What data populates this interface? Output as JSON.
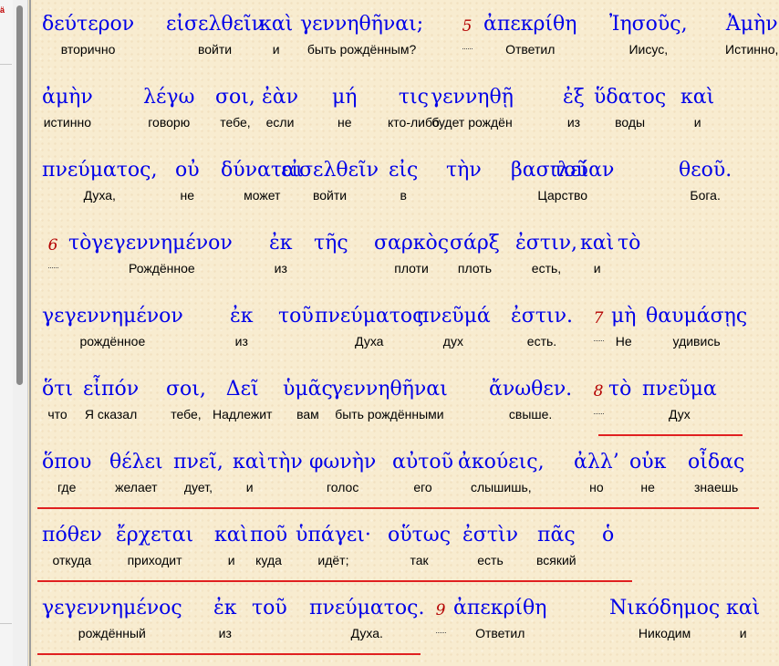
{
  "colors": {
    "greek": "#0000e8",
    "gloss": "#000000",
    "verse_number": "#b30000",
    "highlight_line": "#e02020",
    "background": "#f8ecd0"
  },
  "left_pane": {
    "marker": "ä"
  },
  "lines": [
    {
      "words": [
        {
          "gk": "δεύτερον",
          "ru": "вторично"
        },
        {
          "gk": "εἰσελθεῖν",
          "ru": "войти"
        },
        {
          "gk": "καὶ",
          "ru": "и"
        },
        {
          "gk": "γεννηθῆναι;",
          "ru": "быть рождённым?"
        },
        {
          "verse": "5"
        },
        {
          "gk": "ἀπεκρίθη",
          "ru": "Ответил"
        },
        {
          "gk": "Ἰησοῦς,",
          "ru": "Иисус,"
        },
        {
          "gk": "Ἀμὴν",
          "ru": "Истинно,"
        }
      ]
    },
    {
      "words": [
        {
          "gk": "ἀμὴν",
          "ru": "истинно"
        },
        {
          "gk": "λέγω",
          "ru": "говорю"
        },
        {
          "gk": "σοι,",
          "ru": "тебе,"
        },
        {
          "gk": "ἐὰν",
          "ru": "если"
        },
        {
          "gk": "μή",
          "ru": "не"
        },
        {
          "gk": "τις",
          "ru": "кто-либо"
        },
        {
          "gk": "γεννηθῇ",
          "ru": "будет рождён"
        },
        {
          "gk": "ἐξ",
          "ru": "из"
        },
        {
          "gk": "ὕδατος",
          "ru": "воды"
        },
        {
          "gk": "καὶ",
          "ru": "и"
        }
      ]
    },
    {
      "words": [
        {
          "gk": "πνεύματος,",
          "ru": "Духа,"
        },
        {
          "gk": "οὐ",
          "ru": "не"
        },
        {
          "gk": "δύναται",
          "ru": "может"
        },
        {
          "gk": "εἰσελθεῖν",
          "ru": "войти"
        },
        {
          "gk": "εἰς",
          "ru": "в"
        },
        {
          "gk": "τὴν",
          "ru": ""
        },
        {
          "gk": "βασιλείαν",
          "ru": "Царство"
        },
        {
          "gk": "τοῦ",
          "ru": ""
        },
        {
          "gk": "θεοῦ.",
          "ru": "Бога."
        }
      ]
    },
    {
      "words": [
        {
          "verse": "6"
        },
        {
          "gk": "τὸ",
          "ru": ""
        },
        {
          "gk": "γεγεννημένον",
          "ru": "Рождённое"
        },
        {
          "gk": "ἐκ",
          "ru": "из"
        },
        {
          "gk": "τῆς",
          "ru": ""
        },
        {
          "gk": "σαρκὸς",
          "ru": "плоти"
        },
        {
          "gk": "σάρξ",
          "ru": "плоть"
        },
        {
          "gk": "ἐστιν,",
          "ru": "есть,"
        },
        {
          "gk": "καὶ",
          "ru": "и"
        },
        {
          "gk": "τὸ",
          "ru": ""
        }
      ]
    },
    {
      "words": [
        {
          "gk": "γεγεννημένον",
          "ru": "рождённое"
        },
        {
          "gk": "ἐκ",
          "ru": "из"
        },
        {
          "gk": "τοῦ",
          "ru": ""
        },
        {
          "gk": "πνεύματος",
          "ru": "Духа"
        },
        {
          "gk": "πνεῦμά",
          "ru": "дух"
        },
        {
          "gk": "ἐστιν.",
          "ru": "есть."
        },
        {
          "verse": "7"
        },
        {
          "gk": "μὴ",
          "ru": "Не"
        },
        {
          "gk": "θαυμάσῃς",
          "ru": "удивись"
        }
      ]
    },
    {
      "words": [
        {
          "gk": "ὅτι",
          "ru": "что"
        },
        {
          "gk": "εἶπόν",
          "ru": "Я сказал"
        },
        {
          "gk": "σοι,",
          "ru": "тебе,"
        },
        {
          "gk": "Δεῖ",
          "ru": "Надлежит"
        },
        {
          "gk": "ὑμᾶς",
          "ru": "вам"
        },
        {
          "gk": "γεννηθῆναι",
          "ru": "быть рождёнными"
        },
        {
          "gk": "ἄνωθεν.",
          "ru": "свыше."
        },
        {
          "verse": "8"
        },
        {
          "gk": "τὸ",
          "ru": ""
        },
        {
          "gk": "πνεῦμα",
          "ru": "Дух"
        }
      ]
    },
    {
      "words": [
        {
          "gk": "ὅπου",
          "ru": "где"
        },
        {
          "gk": "θέλει",
          "ru": "желает"
        },
        {
          "gk": "πνεῖ,",
          "ru": "дует,"
        },
        {
          "gk": "καὶ",
          "ru": "и"
        },
        {
          "gk": "τὴν",
          "ru": ""
        },
        {
          "gk": "φωνὴν",
          "ru": "голос"
        },
        {
          "gk": "αὐτοῦ",
          "ru": "его"
        },
        {
          "gk": "ἀκούεις,",
          "ru": "слышишь,"
        },
        {
          "gk": "ἀλλ’",
          "ru": "но"
        },
        {
          "gk": "οὐκ",
          "ru": "не"
        },
        {
          "gk": "οἶδας",
          "ru": "знаешь"
        }
      ]
    },
    {
      "words": [
        {
          "gk": "πόθεν",
          "ru": "откуда"
        },
        {
          "gk": "ἔρχεται",
          "ru": "приходит"
        },
        {
          "gk": "καὶ",
          "ru": "и"
        },
        {
          "gk": "ποῦ",
          "ru": "куда"
        },
        {
          "gk": "ὑπάγει·",
          "ru": "идёт;"
        },
        {
          "gk": "οὕτως",
          "ru": "так"
        },
        {
          "gk": "ἐστὶν",
          "ru": "есть"
        },
        {
          "gk": "πᾶς",
          "ru": "всякий"
        },
        {
          "gk": "ὁ",
          "ru": ""
        }
      ]
    },
    {
      "words": [
        {
          "gk": "γεγεννημένος",
          "ru": "рождённый"
        },
        {
          "gk": "ἐκ",
          "ru": "из"
        },
        {
          "gk": "τοῦ",
          "ru": ""
        },
        {
          "gk": "πνεύματος.",
          "ru": "Духа."
        },
        {
          "verse": "9"
        },
        {
          "gk": "ἀπεκρίθη",
          "ru": "Ответил"
        },
        {
          "gk": "Νικόδημος",
          "ru": "Никодим"
        },
        {
          "gk": "καὶ",
          "ru": "и"
        }
      ]
    }
  ]
}
